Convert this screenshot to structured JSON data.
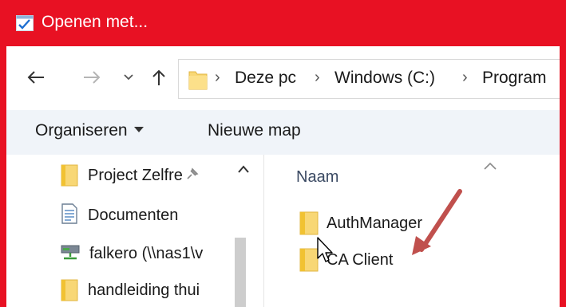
{
  "window": {
    "title": "Openen met...",
    "accent_color": "#e81123",
    "title_icon": "openwith-app-icon"
  },
  "navigation": {
    "back_icon": "back-arrow-icon",
    "forward_icon": "forward-arrow-icon",
    "recent_icon": "chevron-down-icon",
    "up_icon": "up-arrow-icon",
    "breadcrumbs": [
      "Deze pc",
      "Windows (C:)",
      "Program"
    ]
  },
  "toolbar": {
    "organize_label": "Organiseren",
    "new_folder_label": "Nieuwe map"
  },
  "nav_pane": {
    "items": [
      {
        "label": "Project Zelfre",
        "icon": "folder-icon",
        "pinned": true
      },
      {
        "label": "Documenten",
        "icon": "documents-icon"
      },
      {
        "label": "falkero (\\\\nas1\\v",
        "icon": "network-drive-icon"
      },
      {
        "label": "handleiding thui",
        "icon": "folder-icon"
      }
    ]
  },
  "file_pane": {
    "column_header": "Naam",
    "items": [
      {
        "label": "AuthManager",
        "icon": "folder-icon"
      },
      {
        "label": "CA Client",
        "icon": "folder-icon"
      }
    ]
  },
  "annotation": {
    "arrow_color": "#c0504d"
  }
}
